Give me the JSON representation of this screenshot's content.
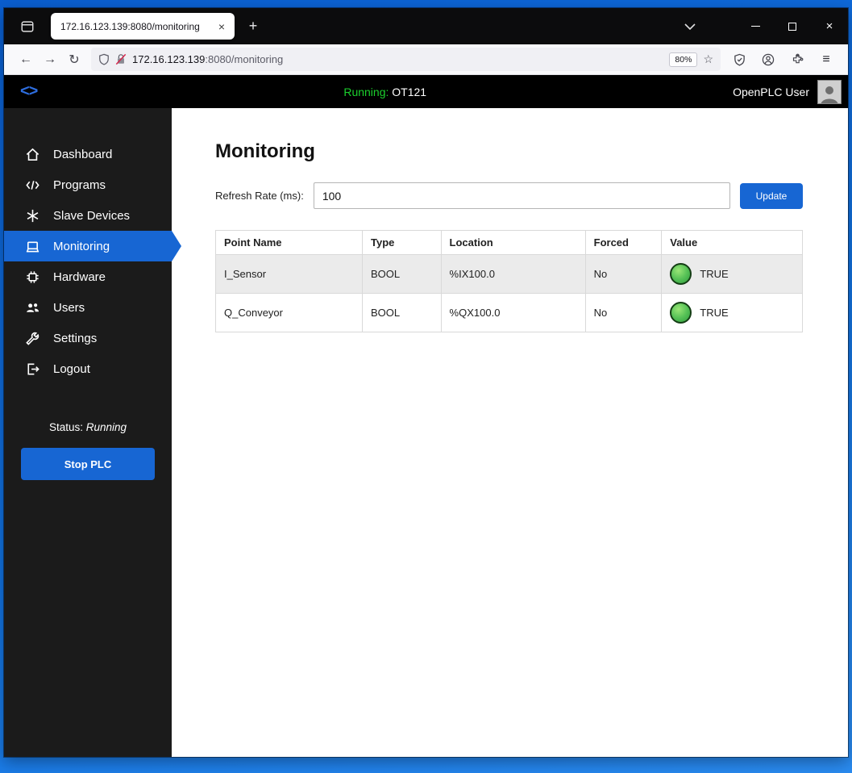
{
  "browser": {
    "tab": {
      "title": "172.16.123.139:8080/monitoring",
      "close_glyph": "×",
      "new_tab_glyph": "+"
    },
    "window_controls": {
      "close_glyph": "×"
    },
    "nav": {
      "back_glyph": "←",
      "forward_glyph": "→",
      "reload_glyph": "↻",
      "url_host": "172.16.123.139",
      "url_rest": ":8080/monitoring",
      "zoom_level": "80%",
      "star_glyph": "☆",
      "menu_glyph": "≡"
    }
  },
  "header": {
    "logo_text": "<>",
    "running_label": "Running:",
    "running_value": " OT121",
    "user_name": "OpenPLC User"
  },
  "sidebar": {
    "items": [
      {
        "label": "Dashboard"
      },
      {
        "label": "Programs"
      },
      {
        "label": "Slave Devices"
      },
      {
        "label": "Monitoring"
      },
      {
        "label": "Hardware"
      },
      {
        "label": "Users"
      },
      {
        "label": "Settings"
      },
      {
        "label": "Logout"
      }
    ],
    "active_item": "Monitoring",
    "status_prefix": "Status: ",
    "status_value": "Running",
    "stop_button_label": "Stop PLC"
  },
  "main": {
    "title": "Monitoring",
    "refresh_label": "Refresh Rate (ms):",
    "refresh_value": "100",
    "update_button_label": "Update",
    "table": {
      "headers": [
        "Point Name",
        "Type",
        "Location",
        "Forced",
        "Value"
      ],
      "rows": [
        {
          "point_name": "I_Sensor",
          "type": "BOOL",
          "location": "%IX100.0",
          "forced": "No",
          "value": "TRUE"
        },
        {
          "point_name": "Q_Conveyor",
          "type": "BOOL",
          "location": "%QX100.0",
          "forced": "No",
          "value": "TRUE"
        }
      ]
    }
  },
  "colors": {
    "accent_blue": "#1766d3",
    "running_green": "#1bd12d",
    "led_green": "#4caf50",
    "sidebar_bg": "#1b1b1b",
    "header_bg": "#000000"
  }
}
